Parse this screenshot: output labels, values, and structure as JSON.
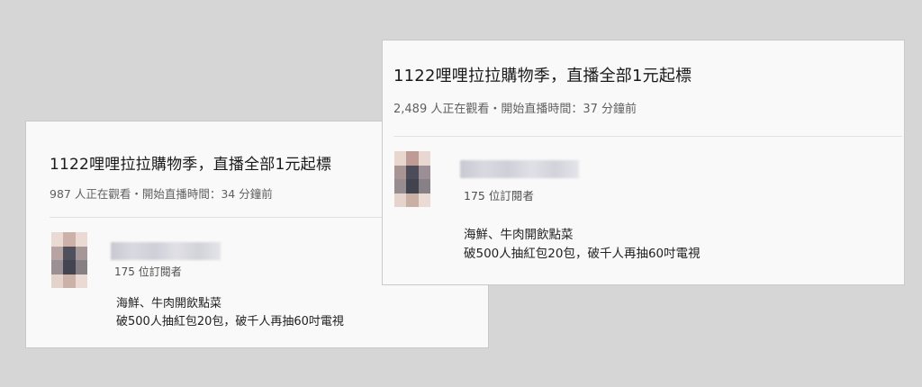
{
  "cards": [
    {
      "title": "1122哩哩拉拉購物季，直播全部1元起標",
      "meta": "987 人正在觀看・開始直播時間：34 分鐘前",
      "subscribers": "175 位訂閱者",
      "description_line1": "海鮮、牛肉開飲點菜",
      "description_line2": "破500人抽紅包20包，破千人再抽60吋電視"
    },
    {
      "title": "1122哩哩拉拉購物季，直播全部1元起標",
      "meta": "2,489 人正在觀看・開始直播時間：37 分鐘前",
      "subscribers": "175 位訂閱者",
      "description_line1": "海鮮、牛肉開飲點菜",
      "description_line2": "破500人抽紅包20包，破千人再抽60吋電視"
    }
  ],
  "avatar_icon": "blurred-channel-avatar",
  "colors": {
    "background": "#d6d6d6",
    "card": "#f9f9f9",
    "title_text": "#1a1a1a",
    "meta_text": "#606060"
  }
}
